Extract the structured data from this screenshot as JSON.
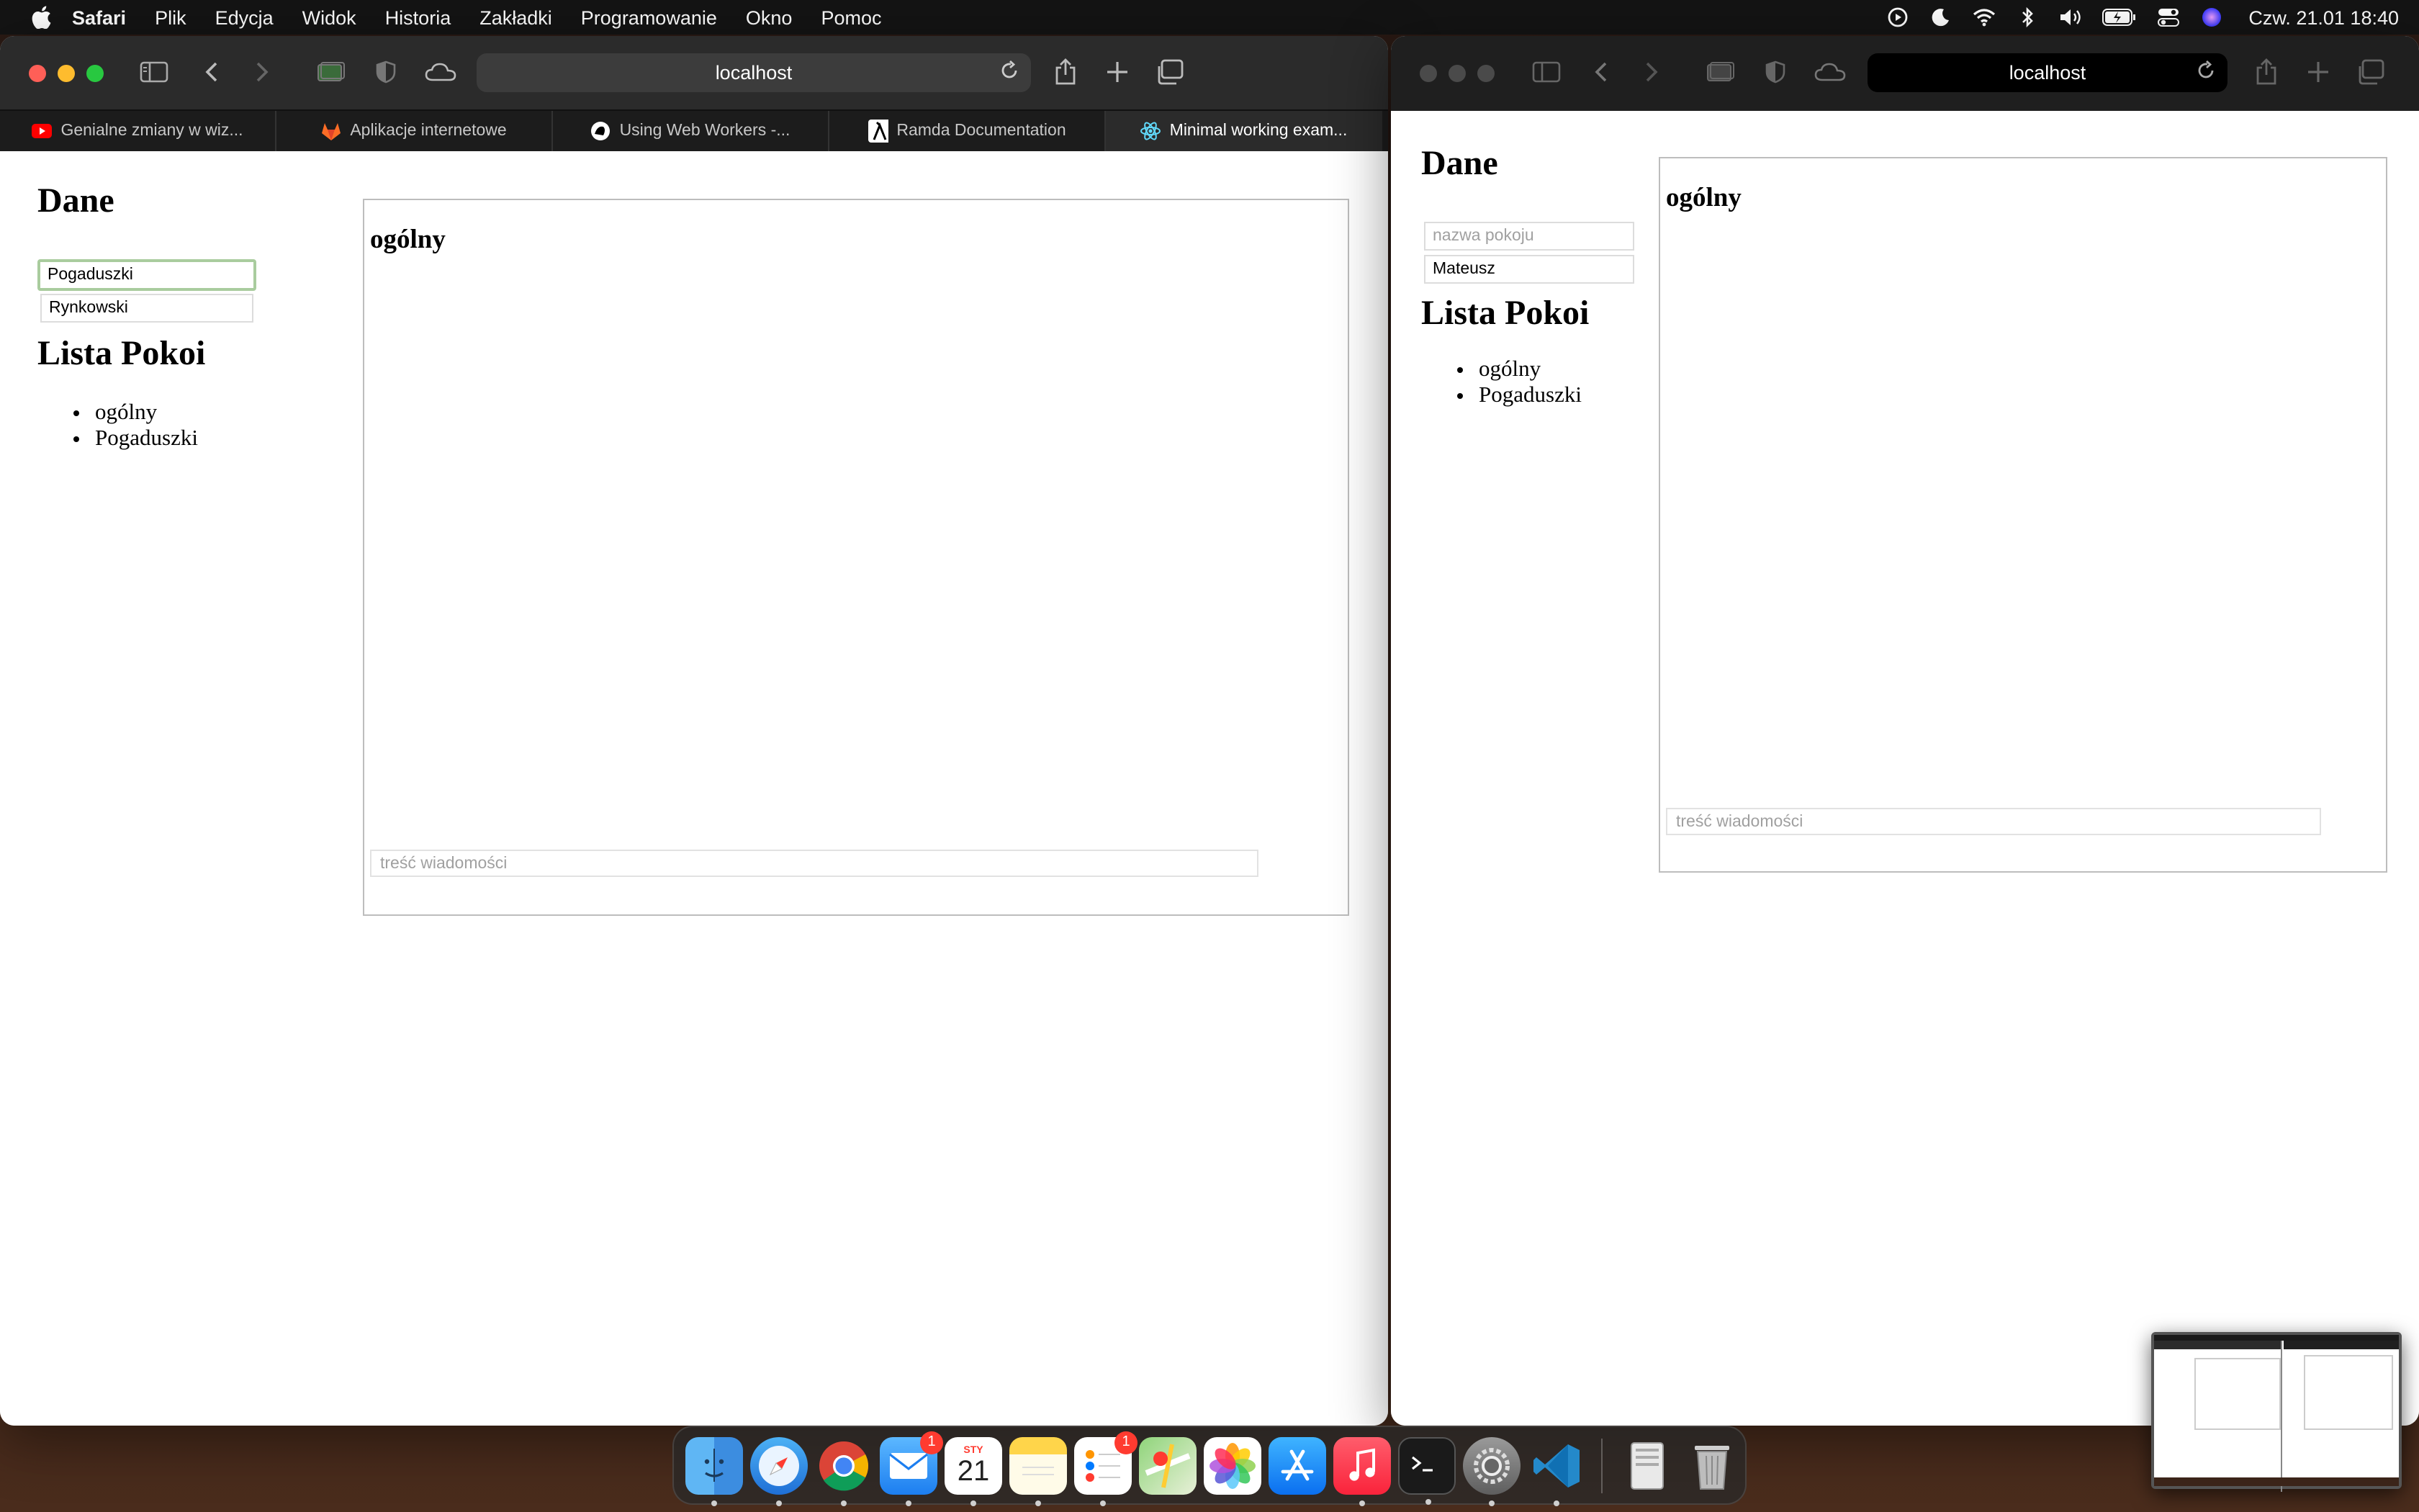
{
  "menubar": {
    "app_name": "Safari",
    "menus": [
      "Plik",
      "Edycja",
      "Widok",
      "Historia",
      "Zakładki",
      "Programowanie",
      "Okno",
      "Pomoc"
    ],
    "clock": "Czw. 21.01  18:40",
    "tray_icons": [
      "play-circle-icon",
      "moon-icon",
      "wifi-icon",
      "bluetooth-icon",
      "volume-icon",
      "battery-icon",
      "control-center-icon",
      "siri-icon"
    ]
  },
  "left_window": {
    "address": "localhost",
    "tabs": [
      {
        "label": "Genialne zmiany w wiz...",
        "icon": "youtube-icon",
        "color": "#ff0000"
      },
      {
        "label": "Aplikacje internetowe",
        "icon": "gitlab-icon",
        "color": "#fc6d26"
      },
      {
        "label": "Using Web Workers -...",
        "icon": "mdn-icon",
        "color": "#ffffff"
      },
      {
        "label": "Ramda Documentation",
        "icon": "ramda-icon",
        "color": "#ffffff"
      },
      {
        "label": "Minimal working exam...",
        "icon": "react-icon",
        "color": "#61dafb"
      }
    ],
    "page": {
      "data_heading": "Dane",
      "field1_value": "Pogaduszki",
      "field2_value": "Rynkowski",
      "rooms_heading": "Lista Pokoi",
      "rooms": [
        "ogólny",
        "Pogaduszki"
      ],
      "chat_title": "ogólny",
      "message_placeholder": "treść wiadomości"
    }
  },
  "right_window": {
    "address": "localhost",
    "page": {
      "data_heading": "Dane",
      "room_name_placeholder": "nazwa pokoju",
      "field2_value": "Mateusz",
      "rooms_heading": "Lista Pokoi",
      "rooms": [
        "ogólny",
        "Pogaduszki"
      ],
      "chat_title": "ogólny",
      "message_placeholder": "treść wiadomości"
    }
  },
  "dock": {
    "calendar_month": "STY",
    "calendar_day": "21",
    "mail_badge": "1",
    "reminders_badge": "1",
    "apps": [
      "finder-icon",
      "safari-icon",
      "chrome-icon",
      "mail-icon",
      "calendar-icon",
      "notes-icon",
      "reminders-icon",
      "maps-icon",
      "photos-icon",
      "app-store-icon",
      "music-icon",
      "terminal-icon",
      "system-preferences-icon",
      "vscode-icon",
      "documents-icon",
      "trash-icon"
    ]
  }
}
